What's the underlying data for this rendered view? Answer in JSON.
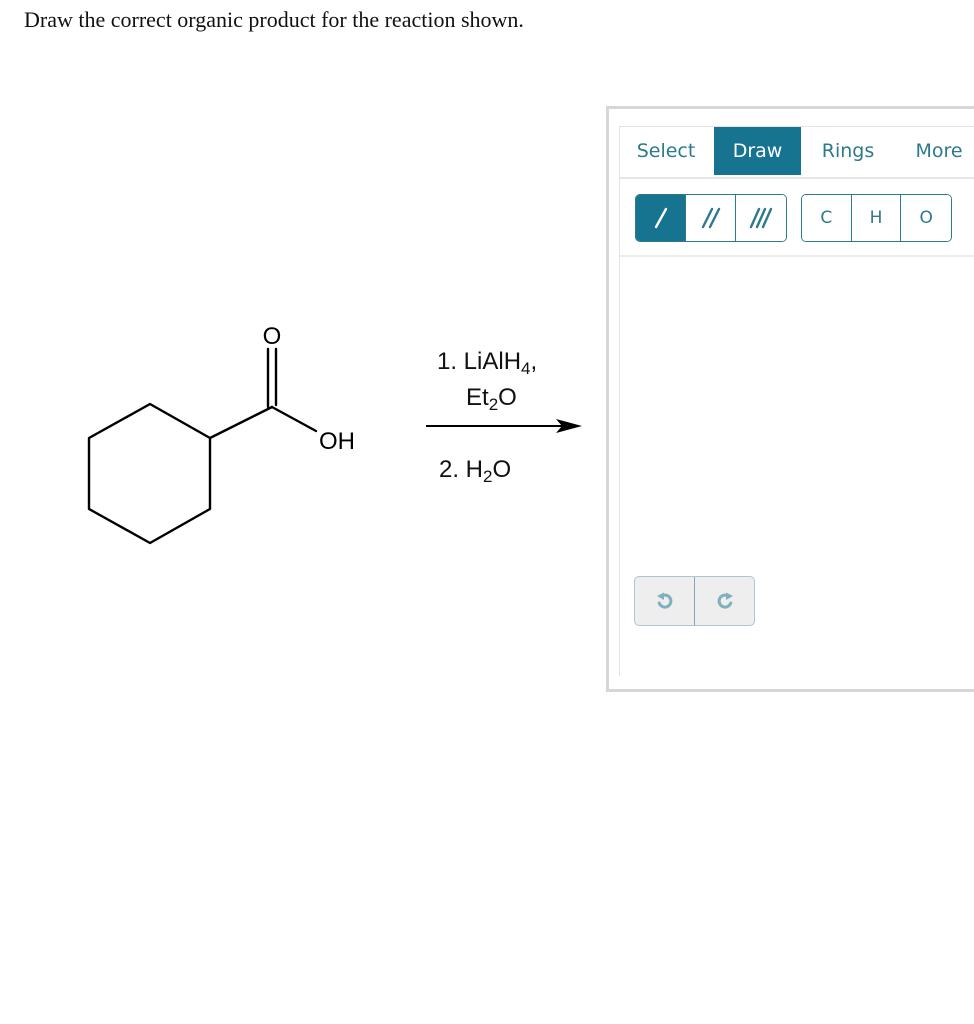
{
  "prompt": "Draw the correct organic product for the reaction shown.",
  "reactant": {
    "name": "cyclohexanecarboxylic acid",
    "atom_labels": {
      "carbonyl_oxygen": "O",
      "hydroxyl": "OH"
    }
  },
  "reagents": {
    "step1_prefix": "1. LiAlH",
    "step1_sub": "4",
    "step1_suffix": ",",
    "step1_solvent_prefix": "Et",
    "step1_solvent_sub": "2",
    "step1_solvent_suffix": "O",
    "step2_prefix": "2. H",
    "step2_sub": "2",
    "step2_suffix": "O"
  },
  "sketcher": {
    "tabs": [
      {
        "label": "Select",
        "active": false
      },
      {
        "label": "Draw",
        "active": true
      },
      {
        "label": "Rings",
        "active": false
      },
      {
        "label": "More",
        "active": false
      }
    ],
    "bond_tools": [
      {
        "name": "single-bond",
        "icon": "single-bond-icon",
        "active": true
      },
      {
        "name": "double-bond",
        "icon": "double-bond-icon",
        "active": false
      },
      {
        "name": "triple-bond",
        "icon": "triple-bond-icon",
        "active": false
      }
    ],
    "atom_tools": [
      {
        "label": "C"
      },
      {
        "label": "H"
      },
      {
        "label": "O"
      }
    ],
    "history": {
      "undo_icon": "undo-icon",
      "redo_icon": "redo-icon"
    },
    "colors": {
      "accent": "#177491",
      "text": "#2c7a8c",
      "history_icon": "#7fb0bc"
    }
  }
}
